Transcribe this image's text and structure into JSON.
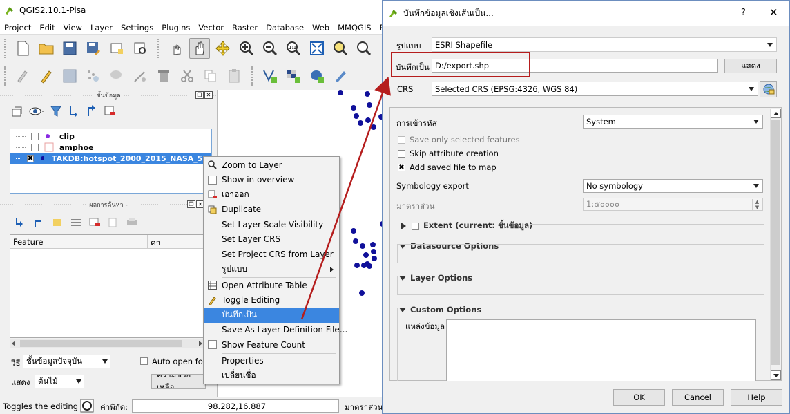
{
  "qgis": {
    "title": "QGIS2.10.1-Pisa",
    "menu": [
      "Project",
      "Edit",
      "View",
      "Layer",
      "Settings",
      "Plugins",
      "Vector",
      "Raster",
      "Database",
      "Web",
      "MMQGIS",
      "Process"
    ],
    "layers_panel_title": "ชั้นข้อมูล",
    "layers": [
      {
        "name": "clip",
        "checked": false,
        "color": "#8a2be2"
      },
      {
        "name": "amphoe",
        "checked": false,
        "color": "#e8a0a0"
      },
      {
        "name": "TAKDB:hotspot_2000_2015_NASA_5...",
        "checked": true,
        "color": "#1010a0"
      }
    ],
    "results_panel_title": "ผลการค้นหา -",
    "table_headers": [
      "Feature",
      "ค่า"
    ],
    "mode_label": "วิธี",
    "mode_value": "ชั้นข้อมูลปัจจุบัน",
    "auto_open_label": "Auto open form",
    "view_label": "แสดง",
    "view_value": "ต้นไม้",
    "help_button": "ความช่วยเหลือ",
    "status_text": "Toggles the editing stat",
    "coord_label": "ค่าพิกัด:",
    "coord_value": "98.282,16.887",
    "scale_label": "มาตราส่วน"
  },
  "context_menu": [
    {
      "label": "Zoom to Layer",
      "icon": "zoom-icon"
    },
    {
      "label": "Show in overview",
      "icon": "checkbox-icon"
    },
    {
      "label": "เอาออก",
      "icon": "remove-layer-icon"
    },
    {
      "label": "Duplicate",
      "icon": "duplicate-icon"
    },
    {
      "label": "Set Layer Scale Visibility",
      "icon": ""
    },
    {
      "label": "Set Layer CRS",
      "icon": ""
    },
    {
      "label": "Set Project CRS from Layer",
      "icon": ""
    },
    {
      "label": "รูปแบบ",
      "icon": "",
      "submenu": true
    },
    {
      "label": "Open Attribute Table",
      "icon": "table-icon"
    },
    {
      "label": "Toggle Editing",
      "icon": "pencil-icon"
    },
    {
      "label": "บันทึกเป็น",
      "icon": "",
      "highlighted": true
    },
    {
      "label": "Save As Layer Definition File...",
      "icon": ""
    },
    {
      "label": "Show Feature Count",
      "icon": "checkbox-icon"
    },
    {
      "label": "Properties",
      "icon": ""
    },
    {
      "label": "เปลี่ยนชื่อ",
      "icon": ""
    }
  ],
  "dialog": {
    "title": "บันทึกข้อมูลเชิงเส้นเป็น...",
    "format_label": "รูปแบบ",
    "format_value": "ESRI Shapefile",
    "save_as_label": "บันทึกเป็น",
    "save_as_value": "D:/export.shp",
    "browse_button": "แสดง",
    "crs_label": "CRS",
    "crs_value": "Selected CRS (EPSG:4326, WGS 84)",
    "encoding_label": "การเข้ารหัส",
    "encoding_value": "System",
    "save_selected_label": "Save only selected features",
    "skip_attr_label": "Skip attribute creation",
    "add_saved_label": "Add saved file to map",
    "symbology_label": "Symbology export",
    "symbology_value": "No symbology",
    "scale_label": "มาตราส่วน",
    "scale_value": "1:๕๐๐๐๐",
    "extent_label": "Extent (current: ชั้นข้อมูล)",
    "datasource_label": "Datasource Options",
    "layer_options_label": "Layer Options",
    "custom_options_label": "Custom Options",
    "datasource_field_label": "แหล่งข้อมูล",
    "ok_button": "OK",
    "cancel_button": "Cancel",
    "help_button": "Help"
  },
  "colors": {
    "accent": "#3b86e0",
    "highlight": "#b51d1d",
    "point": "#10109a"
  }
}
